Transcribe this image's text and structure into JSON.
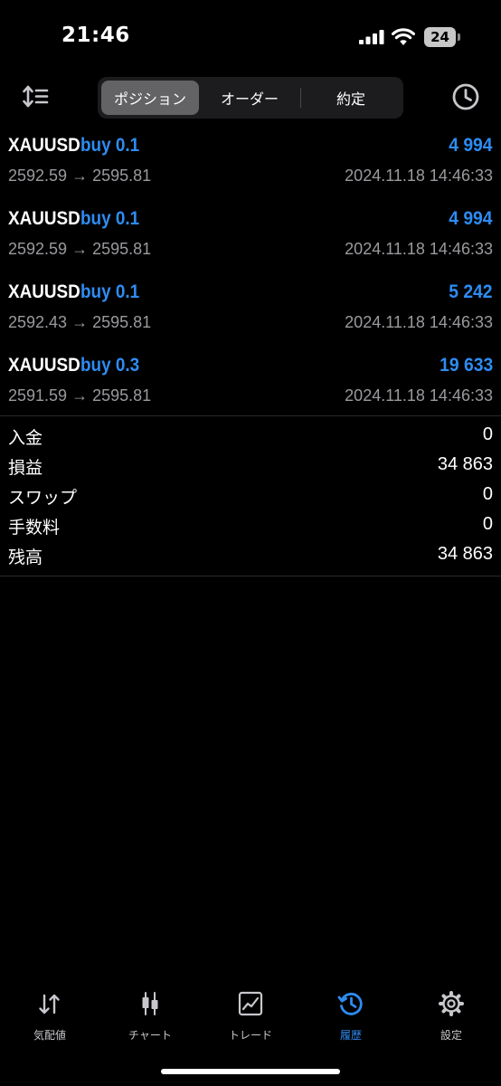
{
  "status_bar": {
    "time": "21:46",
    "battery": "24"
  },
  "toolbar": {
    "sort_icon": "sort-icon",
    "history_icon": "clock-icon",
    "segments": [
      {
        "label": "ポジション",
        "selected": true
      },
      {
        "label": "オーダー",
        "selected": false
      },
      {
        "label": "約定",
        "selected": false
      }
    ]
  },
  "deals": [
    {
      "symbol": "XAUUSD",
      "side": "buy 0.1",
      "profit": "4 994",
      "prices": "2592.59 → 2595.81",
      "time": "2024.11.18 14:46:33"
    },
    {
      "symbol": "XAUUSD",
      "side": "buy 0.1",
      "profit": "4 994",
      "prices": "2592.59 → 2595.81",
      "time": "2024.11.18 14:46:33"
    },
    {
      "symbol": "XAUUSD",
      "side": "buy 0.1",
      "profit": "5 242",
      "prices": "2592.43 → 2595.81",
      "time": "2024.11.18 14:46:33"
    },
    {
      "symbol": "XAUUSD",
      "side": "buy 0.3",
      "profit": "19 633",
      "prices": "2591.59 → 2595.81",
      "time": "2024.11.18 14:46:33"
    }
  ],
  "summary": [
    {
      "label": "入金",
      "value": "0"
    },
    {
      "label": "損益",
      "value": "34 863"
    },
    {
      "label": "スワップ",
      "value": "0"
    },
    {
      "label": "手数料",
      "value": "0"
    },
    {
      "label": "残高",
      "value": "34 863"
    }
  ],
  "tabbar": {
    "tabs": [
      {
        "label": "気配値",
        "icon": "quotes-arrows-icon",
        "active": false
      },
      {
        "label": "チャート",
        "icon": "candlestick-icon",
        "active": false
      },
      {
        "label": "トレード",
        "icon": "trade-chart-icon",
        "active": false
      },
      {
        "label": "履歴",
        "icon": "history-icon",
        "active": true
      },
      {
        "label": "設定",
        "icon": "gear-icon",
        "active": false
      }
    ]
  },
  "colors": {
    "accent": "#2e8cf2",
    "background": "#000000",
    "secondary_text": "#9a9a9f"
  }
}
